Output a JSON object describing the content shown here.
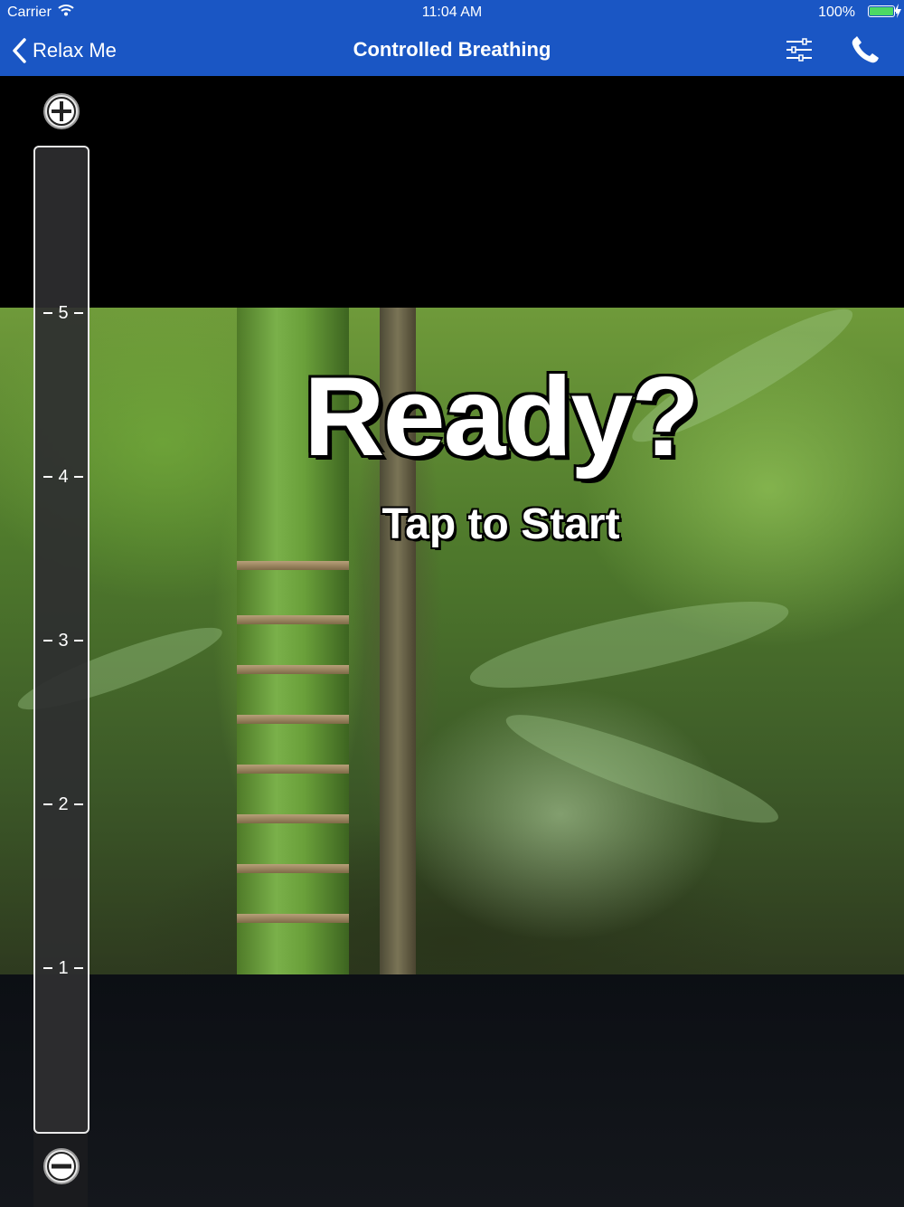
{
  "status_bar": {
    "carrier": "Carrier",
    "time": "11:04 AM",
    "battery_percent": "100%",
    "battery_level": 1.0,
    "battery_color": "#4cd964"
  },
  "nav_bar": {
    "back_label": "Relax Me",
    "title": "Controlled Breathing",
    "background_color": "#1a56c4",
    "icons": [
      "chevron-left-icon",
      "sliders-icon",
      "phone-icon"
    ]
  },
  "main": {
    "headline": "Ready?",
    "subtitle": "Tap to Start"
  },
  "level_slider": {
    "ticks": [
      "5",
      "4",
      "3",
      "2",
      "1"
    ],
    "increase_icon": "plus-circle-icon",
    "decrease_icon": "minus-circle-icon"
  }
}
